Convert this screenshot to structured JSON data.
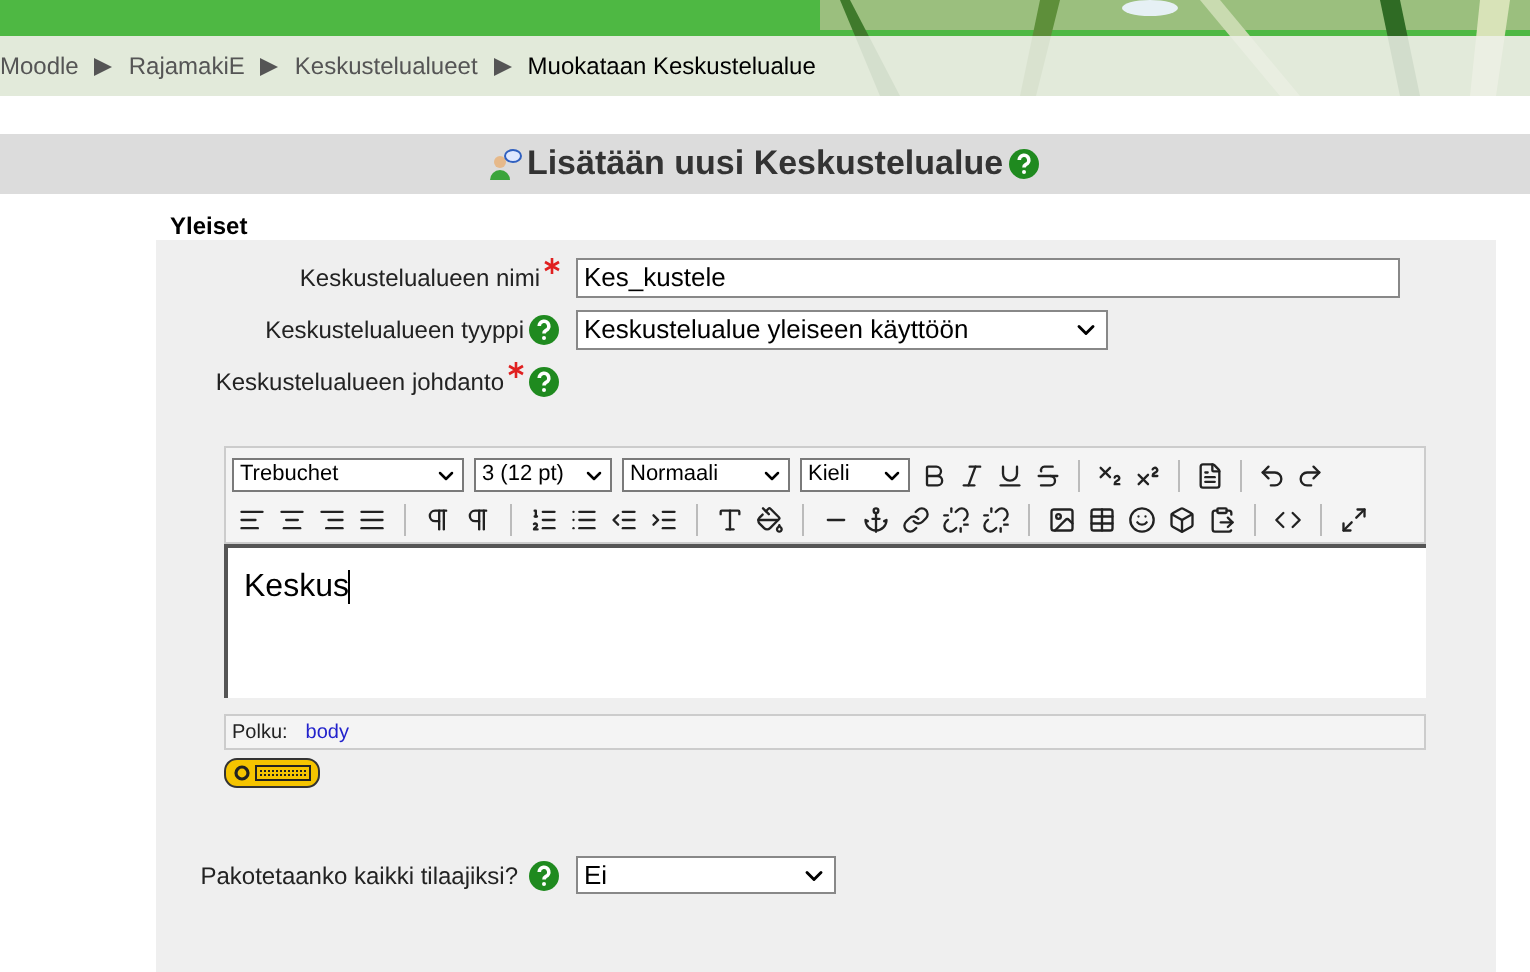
{
  "breadcrumb": [
    {
      "label": "Moodle",
      "current": false
    },
    {
      "label": "RajamakiE",
      "current": false
    },
    {
      "label": "Keskustelualueet",
      "current": false
    },
    {
      "label": "Muokataan Keskustelualue",
      "current": true
    }
  ],
  "heading": "Lisätään uusi Keskustelualue",
  "fieldset": {
    "legend": "Yleiset"
  },
  "fields": [
    {
      "kind": "text",
      "label": "Keskustelualueen nimi",
      "required": true,
      "help": false,
      "value": "Kes_kustele"
    },
    {
      "kind": "select",
      "label": "Keskustelualueen tyyppi",
      "required": false,
      "help": true,
      "value": "Keskustelualue yleiseen käyttöön"
    },
    {
      "kind": "editor",
      "label": "Keskustelualueen johdanto",
      "required": true,
      "help": true
    }
  ],
  "editor": {
    "font": "Trebuchet",
    "size": "3 (12 pt)",
    "format": "Normaali",
    "language": "Kieli",
    "content": "Keskus",
    "path_label": "Polku:",
    "path": "body"
  },
  "more_fields": [
    {
      "label": "Pakotetaanko kaikki tilaajiksi?",
      "help": true,
      "value": "Ei"
    }
  ]
}
